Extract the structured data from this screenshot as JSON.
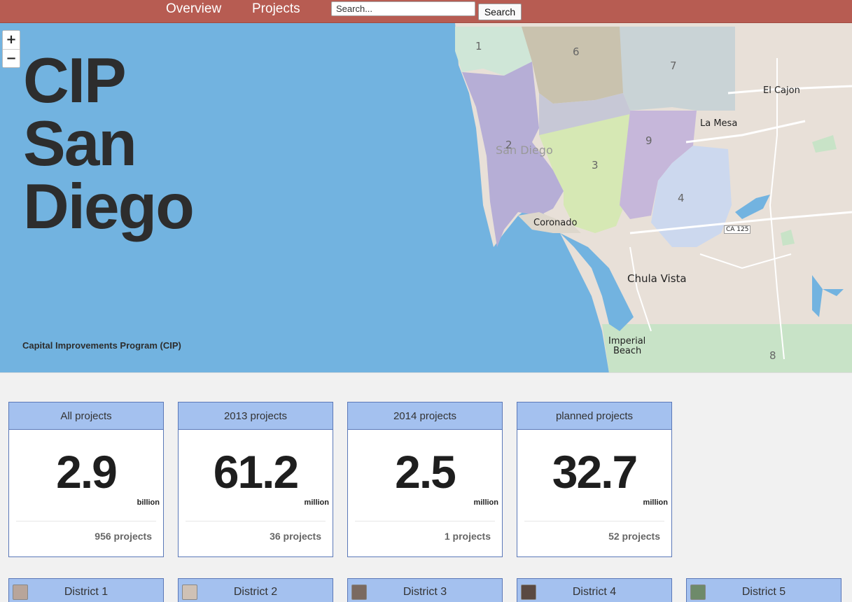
{
  "nav": {
    "overview": "Overview",
    "projects": "Projects",
    "search_placeholder": "Search...",
    "search_button": "Search"
  },
  "hero": {
    "title_lines": [
      "CIP",
      "San",
      "Diego"
    ],
    "subtitle": "Capital Improvements Program (CIP)",
    "zoom_in": "+",
    "zoom_out": "−"
  },
  "map": {
    "places": [
      "El Cajon",
      "La Mesa",
      "San Diego",
      "Coronado",
      "Chula Vista",
      "Imperial",
      "Beach",
      "CA 125"
    ],
    "district_numbers": [
      "1",
      "2",
      "3",
      "4",
      "6",
      "7",
      "8",
      "9"
    ]
  },
  "stats": [
    {
      "title": "All projects",
      "value": "2.9",
      "unit": "billion",
      "count": "956 projects"
    },
    {
      "title": "2013 projects",
      "value": "61.2",
      "unit": "million",
      "count": "36 projects"
    },
    {
      "title": "2014 projects",
      "value": "2.5",
      "unit": "million",
      "count": "1 projects"
    },
    {
      "title": "planned projects",
      "value": "32.7",
      "unit": "million",
      "count": "52 projects"
    }
  ],
  "districts": [
    {
      "label": "District 1"
    },
    {
      "label": "District 2"
    },
    {
      "label": "District 3"
    },
    {
      "label": "District 4"
    },
    {
      "label": "District 5"
    }
  ],
  "colors": {
    "nav_bg": "#b75c52",
    "ocean": "#72b3e0",
    "card_header": "#a4c1ef",
    "card_border": "#5b78b8"
  }
}
